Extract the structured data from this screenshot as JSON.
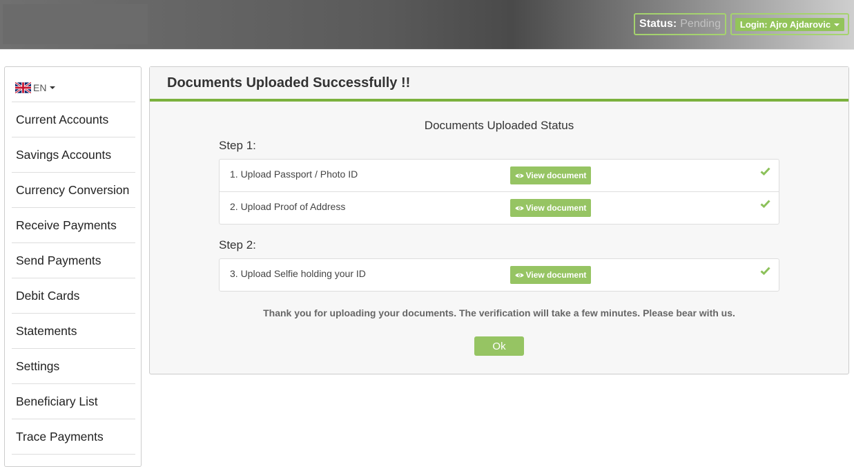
{
  "header": {
    "status_label": "Status:",
    "status_value": "Pending",
    "login_label": "Login: Ajro Ajdarovic"
  },
  "sidebar": {
    "language": "EN",
    "items": [
      {
        "label": "Current Accounts"
      },
      {
        "label": "Savings Accounts"
      },
      {
        "label": "Currency Conversion"
      },
      {
        "label": "Receive Payments"
      },
      {
        "label": "Send Payments"
      },
      {
        "label": "Debit Cards"
      },
      {
        "label": "Statements"
      },
      {
        "label": "Settings"
      },
      {
        "label": "Beneficiary List"
      },
      {
        "label": "Trace Payments"
      }
    ]
  },
  "main": {
    "title": "Documents Uploaded Successfully !!",
    "subtitle": "Documents Uploaded Status",
    "step1_label": "Step 1:",
    "step2_label": "Step 2:",
    "documents": [
      {
        "label": "1. Upload Passport / Photo ID",
        "button": "View document"
      },
      {
        "label": "2. Upload Proof of Address",
        "button": "View document"
      },
      {
        "label": "3. Upload Selfie holding your ID",
        "button": "View document"
      }
    ],
    "message": "Thank you for uploading your documents. The verification will take a few minutes. Please bear with us.",
    "ok_label": "Ok"
  },
  "colors": {
    "accent_green": "#96c463",
    "header_rule": "#7bb13d",
    "status_pending": "#c2c2c2"
  },
  "icons": [
    "uk-flag-icon",
    "caret-down-icon",
    "eye-icon",
    "check-icon"
  ]
}
